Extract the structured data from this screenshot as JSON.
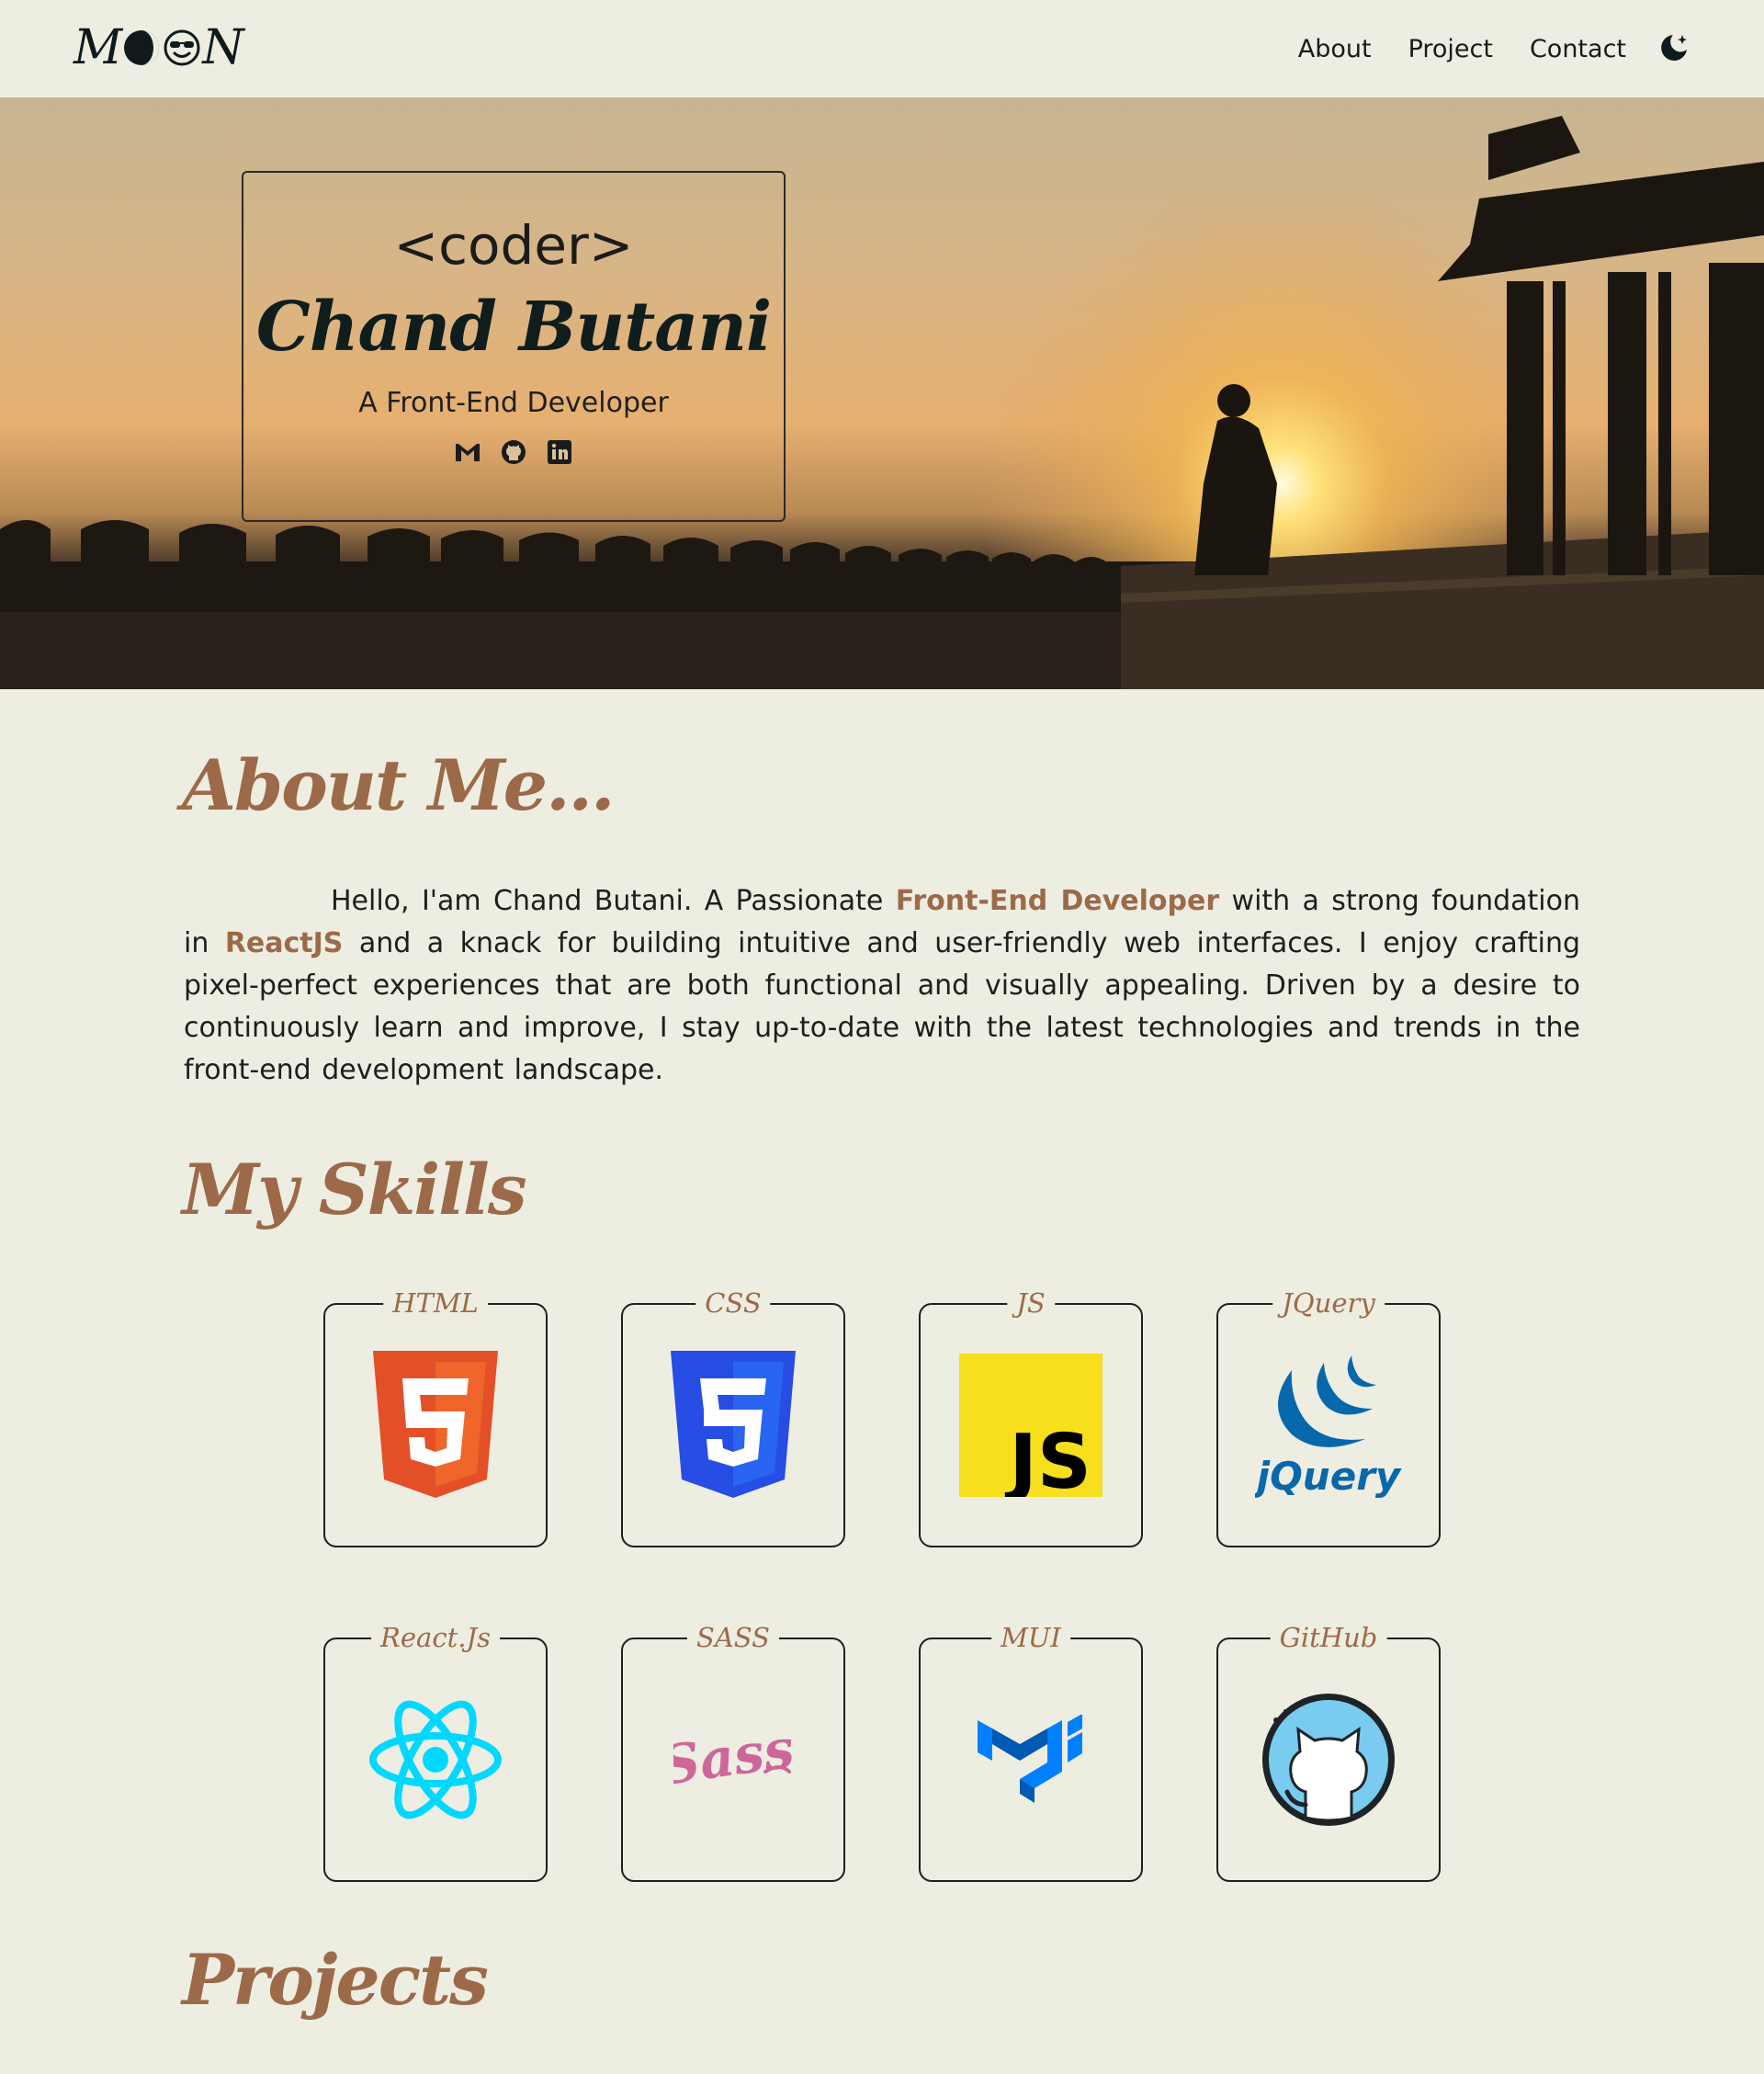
{
  "header": {
    "logo_text_left": "M",
    "logo_text_right": "N",
    "nav": [
      {
        "label": "About"
      },
      {
        "label": "Project"
      },
      {
        "label": "Contact"
      }
    ]
  },
  "hero": {
    "tag": "<coder>",
    "name": "Chand Butani",
    "role": "A Front-End Developer",
    "social_icons": [
      "gmail-icon",
      "github-icon",
      "linkedin-icon"
    ]
  },
  "about": {
    "title": "About Me...",
    "text_1": "Hello, I'am Chand Butani. A Passionate ",
    "highlight_1": "Front-End Developer",
    "text_2": " with a strong foundation in ",
    "highlight_2": "ReactJS",
    "text_3": " and a knack for building intuitive and user-friendly web interfaces. I enjoy crafting pixel-perfect experiences that are both functional and visually appealing. Driven by a desire to continuously learn and improve, I stay up-to-date with the latest technologies and trends in the front-end development landscape."
  },
  "skills": {
    "title": "My Skills",
    "items": [
      {
        "label": "HTML",
        "icon": "html5-icon"
      },
      {
        "label": "CSS",
        "icon": "css3-icon"
      },
      {
        "label": "JS",
        "icon": "javascript-icon"
      },
      {
        "label": "JQuery",
        "icon": "jquery-icon"
      },
      {
        "label": "React.Js",
        "icon": "react-icon"
      },
      {
        "label": "SASS",
        "icon": "sass-icon"
      },
      {
        "label": "MUI",
        "icon": "mui-icon"
      },
      {
        "label": "GitHub",
        "icon": "github-octocat-icon"
      }
    ]
  },
  "projects": {
    "title": "Projects"
  },
  "colors": {
    "background": "#eeede2",
    "accent": "#9c6a48",
    "text": "#1a1a1a"
  }
}
